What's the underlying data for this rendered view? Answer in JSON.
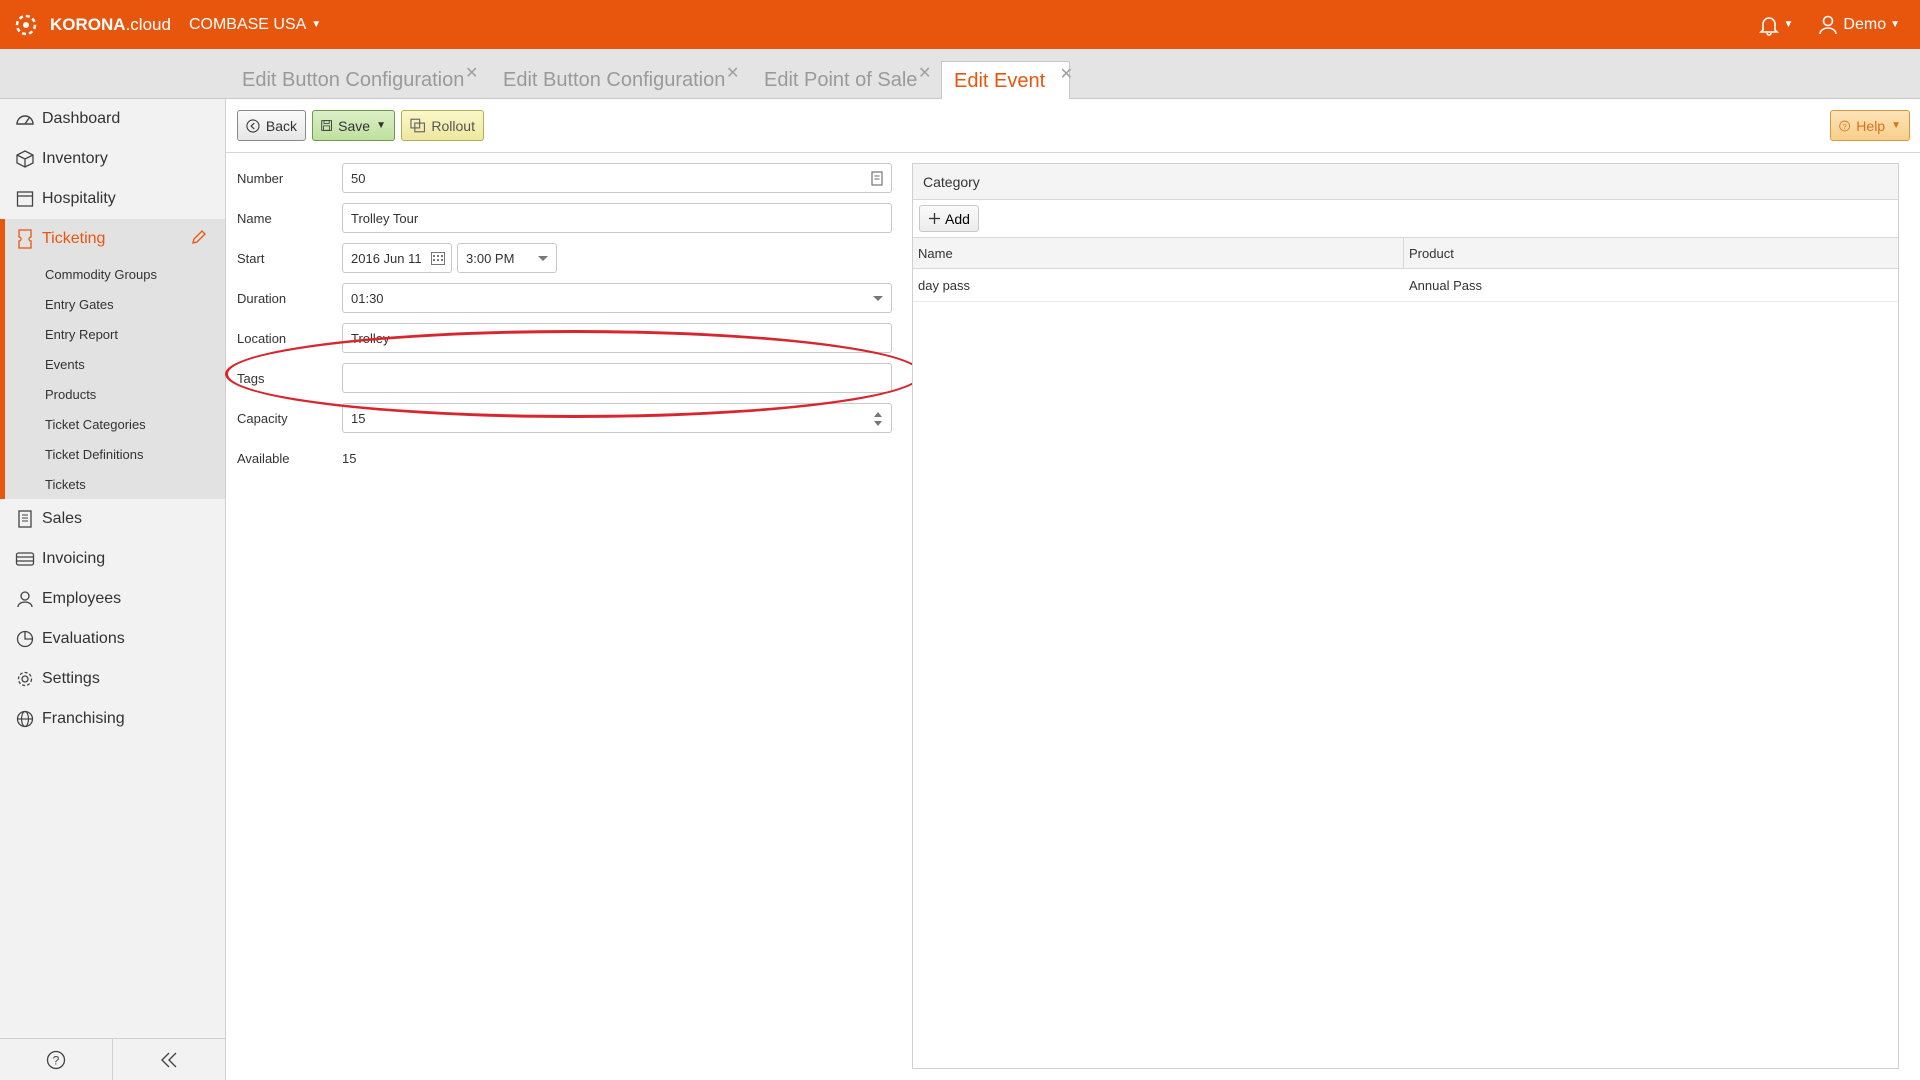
{
  "brand": {
    "logo_bold": "KORONA",
    "logo_light": ".cloud",
    "accent": "#e8560e"
  },
  "header": {
    "company": "COMBASE USA",
    "user": "Demo"
  },
  "tabs": [
    {
      "label": "Edit Button Configuration",
      "active": false
    },
    {
      "label": "Edit Button Configuration",
      "active": false
    },
    {
      "label": "Edit Point of Sale",
      "active": false
    },
    {
      "label": "Edit Event",
      "active": true
    }
  ],
  "sidebar": {
    "items": [
      {
        "label": "Dashboard",
        "icon": "dashboard-icon"
      },
      {
        "label": "Inventory",
        "icon": "box-icon"
      },
      {
        "label": "Hospitality",
        "icon": "hospitality-icon"
      },
      {
        "label": "Ticketing",
        "icon": "ticket-icon",
        "active": true
      },
      {
        "label": "Sales",
        "icon": "receipt-icon"
      },
      {
        "label": "Invoicing",
        "icon": "invoice-icon"
      },
      {
        "label": "Employees",
        "icon": "user-icon"
      },
      {
        "label": "Evaluations",
        "icon": "pie-chart-icon"
      },
      {
        "label": "Settings",
        "icon": "gear-icon"
      },
      {
        "label": "Franchising",
        "icon": "globe-icon"
      }
    ],
    "subitems": [
      "Commodity Groups",
      "Entry Gates",
      "Entry Report",
      "Events",
      "Products",
      "Ticket Categories",
      "Ticket Definitions",
      "Tickets"
    ]
  },
  "toolbar": {
    "back": "Back",
    "save": "Save",
    "rollout": "Rollout",
    "help": "Help"
  },
  "form": {
    "number": {
      "label": "Number",
      "value": "50"
    },
    "name": {
      "label": "Name",
      "value": "Trolley Tour"
    },
    "start": {
      "label": "Start",
      "date": "2016 Jun 11",
      "time": "3:00 PM"
    },
    "duration": {
      "label": "Duration",
      "value": "01:30"
    },
    "location": {
      "label": "Location",
      "value": "Trolley"
    },
    "tags": {
      "label": "Tags",
      "value": ""
    },
    "capacity": {
      "label": "Capacity",
      "value": "15"
    },
    "available": {
      "label": "Available",
      "value": "15"
    }
  },
  "category": {
    "title": "Category",
    "add": "Add",
    "columns": [
      "Name",
      "Product"
    ],
    "rows": [
      {
        "name": "day pass",
        "product": "Annual Pass"
      }
    ]
  },
  "annotation": {
    "color": "#d9252d",
    "target": "Tags"
  }
}
